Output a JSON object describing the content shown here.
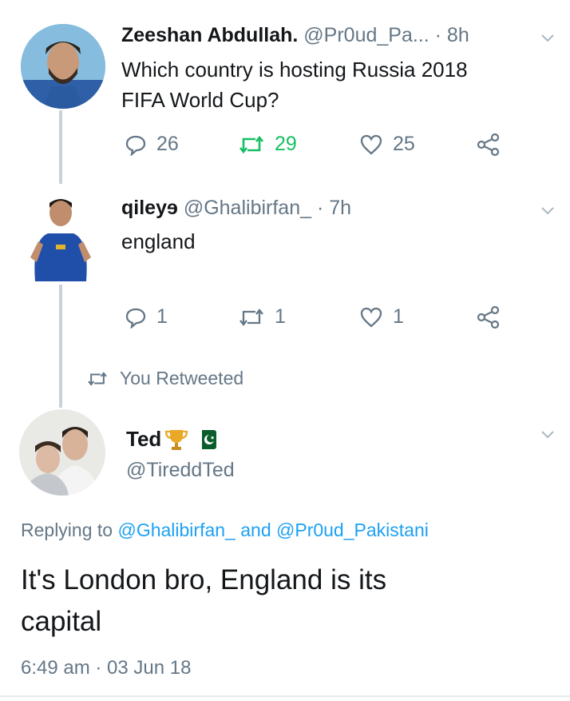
{
  "tweet1": {
    "display_name": "Zeeshan Abdullah.",
    "handle": "@Pr0ud_Pa...",
    "time": "· 8h",
    "text_line1": "Which country is hosting Russia 2018",
    "text_line2": "FIFA World Cup?",
    "reply_count": "26",
    "retweet_count": "29",
    "like_count": "25"
  },
  "tweet2": {
    "display_name": "qileyɘ",
    "handle": "@Ghalibirfan_",
    "time": "· 7h",
    "text": "england",
    "reply_count": "1",
    "retweet_count": "1",
    "like_count": "1"
  },
  "retweet_context": {
    "label": "You Retweeted"
  },
  "tweet3": {
    "display_name": "Ted",
    "handle": "@TireddTed",
    "replying_prefix": "Replying to",
    "replying_user1": "@Ghalibirfan_",
    "replying_and": "and",
    "replying_user2": "@Pr0ud_Pakistani",
    "text_line1": "It's London bro, England is its",
    "text_line2": "capital",
    "timestamp": "6:49 am · 03 Jun 18"
  },
  "colors": {
    "link": "#1da1f2",
    "muted": "#657786",
    "retweet_green": "#17bf63",
    "thread_line": "#c8d2da"
  },
  "icons": [
    "reply-icon",
    "retweet-icon",
    "like-icon",
    "share-icon",
    "chevron-down-icon",
    "trophy-icon",
    "pakistan-flag-icon"
  ]
}
